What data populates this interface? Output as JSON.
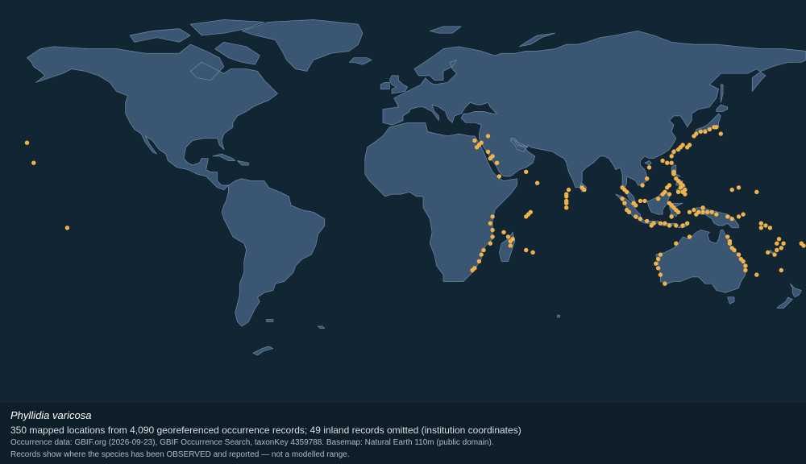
{
  "caption": {
    "species": "Phyllidia varicosa",
    "summary": "350 mapped locations from 4,090 georeferenced occurrence records; 49 inland records omitted (institution coordinates)",
    "source": "Occurrence data: GBIF.org (2026-09-23), GBIF Occurrence Search, taxonKey 4359788. Basemap: Natural Earth 110m (public domain).",
    "note": "Records show where the species has been OBSERVED and reported — not a modelled range."
  },
  "colors": {
    "ocean": "#112632",
    "land": "#3b5673",
    "border": "#6f8aa6",
    "occurrence": "#f2b24a"
  },
  "occurrences": [
    [
      -165,
      19
    ],
    [
      -168,
      28
    ],
    [
      -150,
      -10
    ],
    [
      35,
      28
    ],
    [
      34,
      27
    ],
    [
      33,
      26
    ],
    [
      32,
      29
    ],
    [
      43,
      13
    ],
    [
      42,
      19
    ],
    [
      40,
      22
    ],
    [
      39,
      21
    ],
    [
      38,
      24
    ],
    [
      55,
      15
    ],
    [
      60,
      10
    ],
    [
      38,
      31
    ],
    [
      73,
      4
    ],
    [
      73,
      2
    ],
    [
      73,
      1
    ],
    [
      73,
      -1
    ],
    [
      73,
      5
    ],
    [
      74,
      7
    ],
    [
      80,
      8
    ],
    [
      81,
      7
    ],
    [
      40,
      -5
    ],
    [
      39,
      -8
    ],
    [
      40,
      -11
    ],
    [
      40,
      -14
    ],
    [
      39,
      -17
    ],
    [
      36,
      -20
    ],
    [
      35,
      -22
    ],
    [
      34,
      -25
    ],
    [
      32,
      -28
    ],
    [
      31,
      -29
    ],
    [
      45,
      -12
    ],
    [
      47,
      -14
    ],
    [
      49,
      -15
    ],
    [
      55,
      -20
    ],
    [
      58,
      -21
    ],
    [
      56,
      -4
    ],
    [
      55,
      -5
    ],
    [
      57,
      -3
    ],
    [
      48,
      -18
    ],
    [
      48,
      -16
    ],
    [
      98,
      8
    ],
    [
      99,
      7
    ],
    [
      100,
      6
    ],
    [
      98,
      3
    ],
    [
      99,
      1
    ],
    [
      103,
      1
    ],
    [
      104,
      0
    ],
    [
      100,
      -2
    ],
    [
      101,
      -3
    ],
    [
      104,
      -5
    ],
    [
      106,
      -6
    ],
    [
      109,
      12
    ],
    [
      110,
      17
    ],
    [
      107,
      9
    ],
    [
      106,
      2
    ],
    [
      108,
      2
    ],
    [
      120,
      22
    ],
    [
      121,
      24
    ],
    [
      123,
      25
    ],
    [
      124,
      26
    ],
    [
      125,
      27
    ],
    [
      127,
      26
    ],
    [
      128,
      27
    ],
    [
      130,
      31
    ],
    [
      131,
      32
    ],
    [
      133,
      33
    ],
    [
      135,
      33
    ],
    [
      137,
      34
    ],
    [
      139,
      35
    ],
    [
      140,
      35
    ],
    [
      142,
      32
    ],
    [
      118,
      19
    ],
    [
      116,
      20
    ],
    [
      120,
      19
    ],
    [
      121,
      15
    ],
    [
      121,
      14
    ],
    [
      122,
      12
    ],
    [
      123,
      11
    ],
    [
      124,
      10
    ],
    [
      125,
      9
    ],
    [
      124,
      8
    ],
    [
      123,
      6
    ],
    [
      125,
      6
    ],
    [
      126,
      7
    ],
    [
      126,
      5
    ],
    [
      119,
      9
    ],
    [
      118,
      8
    ],
    [
      117,
      6
    ],
    [
      116,
      5
    ],
    [
      114,
      3
    ],
    [
      119,
      5
    ],
    [
      119,
      1
    ],
    [
      120,
      0
    ],
    [
      121,
      -1
    ],
    [
      122,
      -2
    ],
    [
      123,
      -3
    ],
    [
      120,
      -5
    ],
    [
      117,
      -8
    ],
    [
      115,
      -8
    ],
    [
      112,
      -8
    ],
    [
      109,
      -7
    ],
    [
      111,
      -9
    ],
    [
      119,
      -9
    ],
    [
      122,
      -9
    ],
    [
      125,
      -9
    ],
    [
      127,
      -8
    ],
    [
      128,
      -3
    ],
    [
      130,
      -2
    ],
    [
      131,
      -4
    ],
    [
      132,
      -3
    ],
    [
      134,
      -3
    ],
    [
      136,
      -3
    ],
    [
      134,
      -1
    ],
    [
      138,
      -3
    ],
    [
      140,
      -4
    ],
    [
      145,
      -5
    ],
    [
      147,
      -6
    ],
    [
      150,
      -5
    ],
    [
      152,
      -4
    ],
    [
      162,
      -9
    ],
    [
      160,
      -10
    ],
    [
      164,
      -10
    ],
    [
      160,
      -8
    ],
    [
      147,
      7
    ],
    [
      150,
      8
    ],
    [
      158,
      6
    ],
    [
      168,
      -15
    ],
    [
      167,
      -17
    ],
    [
      169,
      -19
    ],
    [
      170,
      -17
    ],
    [
      115,
      -22
    ],
    [
      114,
      -24
    ],
    [
      113,
      -26
    ],
    [
      114,
      -28
    ],
    [
      115,
      -31
    ],
    [
      117,
      -35
    ],
    [
      122,
      -17
    ],
    [
      128,
      -14
    ],
    [
      145,
      -14
    ],
    [
      146,
      -16
    ],
    [
      146,
      -17
    ],
    [
      147,
      -19
    ],
    [
      148,
      -20
    ],
    [
      150,
      -22
    ],
    [
      151,
      -24
    ],
    [
      152,
      -25
    ],
    [
      153,
      -27
    ],
    [
      153,
      -29
    ],
    [
      163,
      -21
    ],
    [
      166,
      -22
    ],
    [
      167,
      -20
    ],
    [
      178,
      -17
    ],
    [
      179,
      -18
    ],
    [
      158,
      -31
    ],
    [
      169,
      -29
    ]
  ]
}
